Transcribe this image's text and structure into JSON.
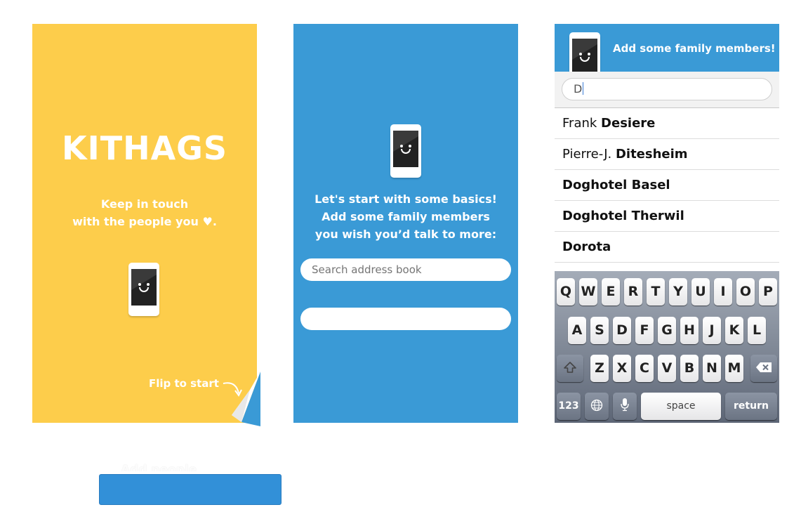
{
  "colors": {
    "yellow": "#fdcd4b",
    "blue": "#3a9ad6",
    "heart": "#ffffff"
  },
  "screen1": {
    "app_title": "KITHAGS",
    "tagline_line1": "Keep in touch",
    "tagline_line2": "with the people you ♥.",
    "flip_label": "Flip to start"
  },
  "screen2": {
    "intro_line1": "Let's start with some basics!",
    "intro_line2": "Add some family members",
    "intro_line3": "you wish you’d talk to more:",
    "search_placeholder": "Search address book",
    "second_field_value": ""
  },
  "screen3": {
    "header_title": "Add some family members!",
    "search_value": "D",
    "contacts": [
      {
        "first": "Frank",
        "last": "Desiere"
      },
      {
        "first": "Pierre-J.",
        "last": "Ditesheim"
      },
      {
        "first": "",
        "last": "Doghotel Basel"
      },
      {
        "first": "",
        "last": "Doghotel Therwil"
      },
      {
        "first": "",
        "last": "Dorota"
      }
    ],
    "keyboard": {
      "row1": [
        "Q",
        "W",
        "E",
        "R",
        "T",
        "Y",
        "U",
        "I",
        "O",
        "P"
      ],
      "row2": [
        "A",
        "S",
        "D",
        "F",
        "G",
        "H",
        "J",
        "K",
        "L"
      ],
      "row3": [
        "Z",
        "X",
        "C",
        "V",
        "B",
        "N",
        "M"
      ],
      "numbers_label": "123",
      "space_label": "space",
      "return_label": "return",
      "icons": {
        "shift": "shift-icon",
        "delete": "delete-icon",
        "globe": "globe-icon",
        "mic": "microphone-icon"
      }
    }
  },
  "bottom_button": {
    "label": "Add people"
  }
}
